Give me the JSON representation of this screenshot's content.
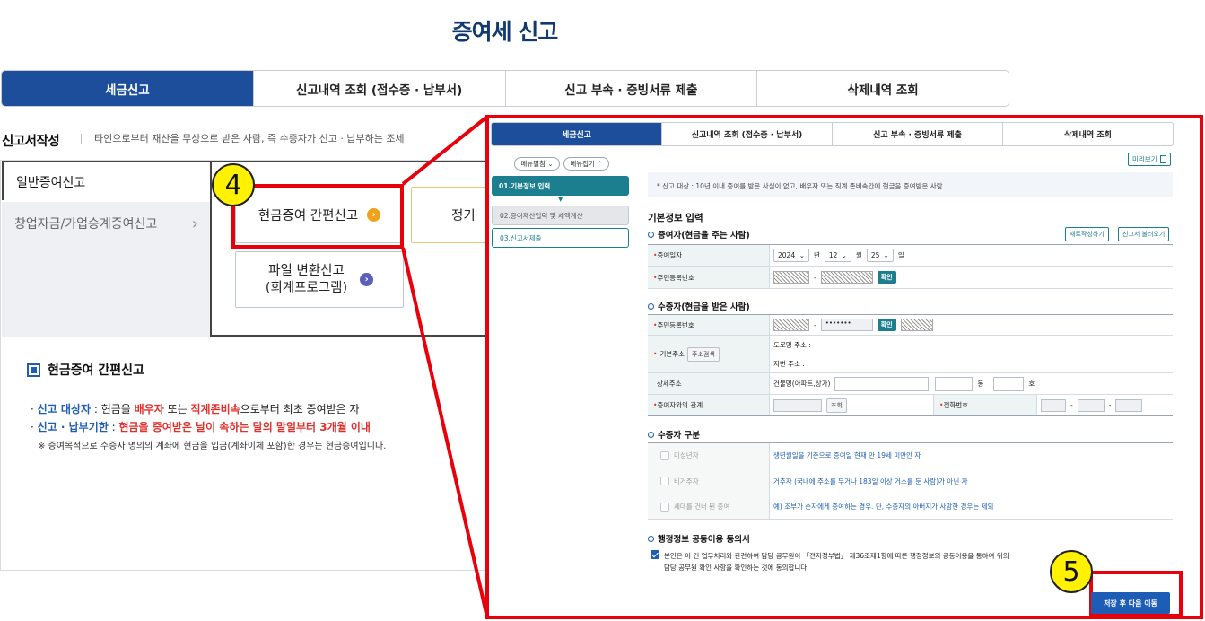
{
  "page_title": "증여세 신고",
  "tabs": [
    "세금신고",
    "신고내역 조회 (접수증 · 납부서)",
    "신고 부속 · 증빙서류 제출",
    "삭제내역 조회"
  ],
  "section": {
    "title": "신고서작성",
    "desc": "타인으로부터 재산을 무상으로 받은 사람, 즉 수증자가 신고 · 납부하는 조세"
  },
  "left_menu": {
    "item1": "일반증여신고",
    "item2": "창업자금/가업승계증여신고",
    "item2_arrow": "›"
  },
  "cards": {
    "cash_simple": "현금증여 간편신고",
    "file_convert_l1": "파일 변환신고",
    "file_convert_l2": "(회계프로그램)",
    "partial": "정기",
    "arrow": "›"
  },
  "note": {
    "title": "현금증여 간편신고",
    "line1_label": "신고 대상자",
    "line1_a": " : 현금을 ",
    "line1_b": "배우자",
    "line1_c": " 또는 ",
    "line1_d": "직계존비속",
    "line1_e": "으로부터 최초 증여받은 자",
    "line2_label": "신고 · 납부기한",
    "line2_a": " : ",
    "line2_b": "현금을 증여받은 날이 속하는 달의 말일부터 3개월 이내",
    "line3": "※ 증여목적으로 수증자 명의의 계좌에 현금을 입금(계좌이체 포함)한 경우는 현금증여입니다."
  },
  "badges": {
    "b4": "4",
    "b5": "5"
  },
  "panel": {
    "tabs": [
      "세금신고",
      "신고내역 조회 (접수증 · 납부서)",
      "신고 부속 · 증빙서류 제출",
      "삭제내역 조회"
    ],
    "menu_expand": "메뉴펼침 ⌄",
    "menu_collapse": "메뉴접기 ⌃",
    "steps": [
      "01.기본정보 입력",
      "02.증여재산입력 및 세액계산",
      "03.신고서제출"
    ],
    "preview": "미리보기",
    "notice": "* 신고 대상 : 10년 이내 증여를 받은 사실이 없고, 배우자 또는 직계 존비속간에 현금을 증여받은 사람",
    "basic_title": "기본정보 입력",
    "donor_title": "증여자(현금을 주는 사람)",
    "new_write": "새로작성하기",
    "load": "신고서 불러오기",
    "gift_date_label": "증여일자",
    "year": "2024",
    "year_unit": "년",
    "month": "12",
    "month_unit": "월",
    "day": "25",
    "day_unit": "일",
    "rrn_label": "주민등록번호",
    "dash": "-",
    "confirm": "확인",
    "donee_title": "수증자(현금을 받은 사람)",
    "rrn_masked": "•••••••",
    "addr_label": "기본주소",
    "addr_search": "주소검색",
    "road_addr": "도로명 주소 :",
    "lot_addr": "지번 주소 :",
    "detail_addr": "상세주소",
    "building": "건물명(아파트,상가)",
    "dong": "동",
    "ho": "호",
    "relation": "증여자와의 관계",
    "lookup": "조회",
    "phone": "전화번호",
    "donee_type_title": "수증자 구분",
    "types": [
      {
        "label": "미성년자",
        "desc": "생년월일을 기준으로 증여일 현재 만 19세 미만인 자"
      },
      {
        "label": "비거주자",
        "desc": "거주자 (국내에 주소를 두거나 183일 이상 거소를 둔 사람)가 아닌 자"
      },
      {
        "label": "세대를 건너 뛴 증여",
        "desc": "예) 조부가 손자에게 증여하는 경우. 단, 수증자의 아버지가 사망한 경우는 제외"
      }
    ],
    "consent_title": "행정정보 공동이용 동의서",
    "consent_l1": "본인은 이 건 업무처리와 관련하여 담당 공무원이 「전자정부법」 제36조제1항에 따른 행정정보의 공동이용을 통하여 위의",
    "consent_l2": "담당 공무원 확인 사항을 확인하는 것에 동의합니다.",
    "save_next": "저장 후 다음 이동"
  },
  "colors": {
    "navy": "#1d4e9c",
    "teal": "#1b7f8f",
    "red": "#e8000b",
    "blue_link": "#1d5db5"
  }
}
